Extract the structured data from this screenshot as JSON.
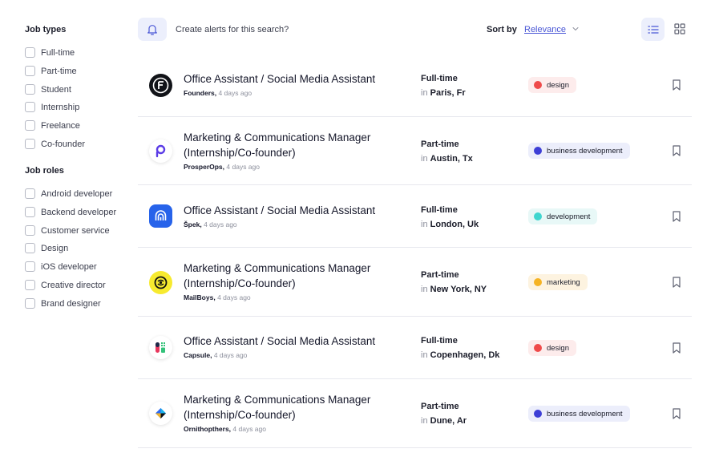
{
  "filters": {
    "job_types_title": "Job types",
    "job_types": [
      "Full-time",
      "Part-time",
      "Student",
      "Internship",
      "Freelance",
      "Co-founder"
    ],
    "job_roles_title": "Job roles",
    "job_roles": [
      "Android developer",
      "Backend developer",
      "Customer service",
      "Design",
      "iOS developer",
      "Creative director",
      "Brand designer"
    ]
  },
  "toolbar": {
    "alert_text": "Create alerts for this search?",
    "sort_label": "Sort by",
    "sort_value": "Relevance",
    "active_view": "list"
  },
  "jobs": [
    {
      "title": "Office Assistant / Social Media Assistant",
      "company": "Founders,",
      "posted": "4 days ago",
      "type": "Full-time",
      "location_prefix": "in",
      "location": "Paris, Fr",
      "tag": "design",
      "tag_color": "#ef4a4a",
      "tag_bg": "#fdecec",
      "logo_icon": "founders-logo-icon"
    },
    {
      "title": "Marketing & Communications Manager (Internship/Co-founder)",
      "company": "ProsperOps,",
      "posted": "4 days ago",
      "type": "Part-time",
      "location_prefix": "in",
      "location": "Austin, Tx",
      "tag": "business development",
      "tag_color": "#3d3fd6",
      "tag_bg": "#eceefb",
      "logo_icon": "prosperops-logo-icon"
    },
    {
      "title": "Office Assistant / Social Media Assistant",
      "company": "Špek,",
      "posted": "4 days ago",
      "type": "Full-time",
      "location_prefix": "in",
      "location": "London, Uk",
      "tag": "development",
      "tag_color": "#3fd6cf",
      "tag_bg": "#e8f8f7",
      "logo_icon": "spek-logo-icon"
    },
    {
      "title": "Marketing & Communications Manager (Internship/Co-founder)",
      "company": "MailBoys,",
      "posted": "4 days ago",
      "type": "Part-time",
      "location_prefix": "in",
      "location": "New York, NY",
      "tag": "marketing",
      "tag_color": "#f5b323",
      "tag_bg": "#fdf3e0",
      "logo_icon": "mailboys-logo-icon"
    },
    {
      "title": "Office Assistant / Social Media Assistant",
      "company": "Capsule,",
      "posted": "4 days ago",
      "type": "Full-time",
      "location_prefix": "in",
      "location": "Copenhagen, Dk",
      "tag": "design",
      "tag_color": "#ef4a4a",
      "tag_bg": "#fdecec",
      "logo_icon": "capsule-logo-icon"
    },
    {
      "title": "Marketing & Communications Manager (Internship/Co-founder)",
      "company": "Ornithopthers,",
      "posted": "4 days ago",
      "type": "Part-time",
      "location_prefix": "in",
      "location": "Dune, Ar",
      "tag": "business development",
      "tag_color": "#3d3fd6",
      "tag_bg": "#eceefb",
      "logo_icon": "ornithopthers-logo-icon"
    }
  ]
}
